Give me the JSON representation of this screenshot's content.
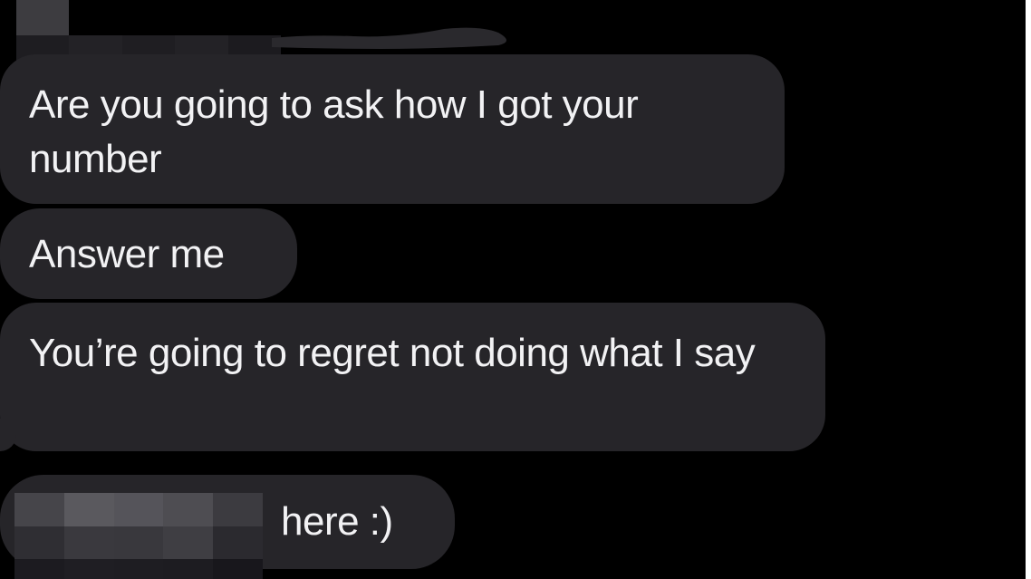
{
  "messages": [
    {
      "id": "m1",
      "text": "Are you going to ask how I got your number"
    },
    {
      "id": "m2",
      "text": "Answer me"
    },
    {
      "id": "m3",
      "text": "You’re going to regret not doing what I say"
    },
    {
      "id": "m4",
      "text": "here :)"
    }
  ],
  "colors": {
    "background": "#000000",
    "bubble": "#262529",
    "text": "#f2f2f4",
    "redaction": [
      "#3a393d",
      "#2e2d31",
      "#232226",
      "#47464a",
      "#555458"
    ]
  }
}
